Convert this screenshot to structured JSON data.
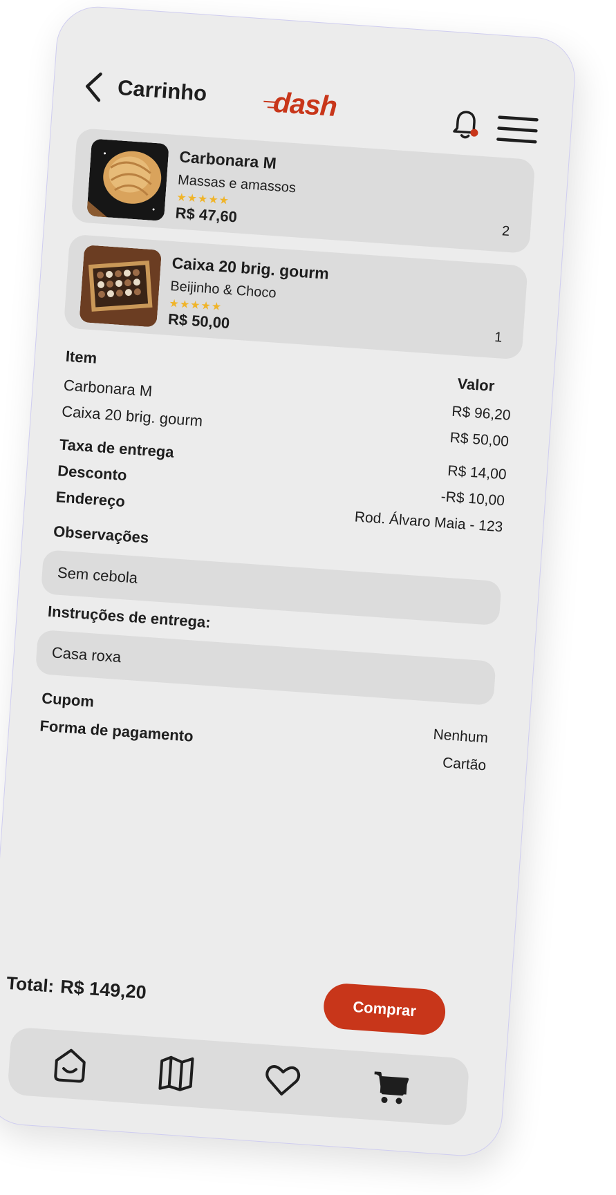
{
  "header": {
    "title": "Carrinho",
    "logo": "dash"
  },
  "cart": [
    {
      "name": "Carbonara M",
      "store": "Massas e amassos",
      "rating": 5,
      "price": "R$ 47,60",
      "quantity": "2"
    },
    {
      "name": "Caixa 20 brig. gourm",
      "store": "Beijinho & Choco",
      "rating": 5,
      "price": "R$ 50,00",
      "quantity": "1"
    }
  ],
  "summary": {
    "item_header": "Item",
    "value_header": "Valor",
    "items": [
      {
        "name": "Carbonara M",
        "value": "R$ 96,20"
      },
      {
        "name": "Caixa 20 brig. gourm",
        "value": "R$ 50,00"
      }
    ],
    "delivery_fee_label": "Taxa de entrega",
    "delivery_fee_value": "R$ 14,00",
    "discount_label": "Desconto",
    "discount_value": "-R$ 10,00",
    "address_label": "Endereço",
    "address_value": "Rod. Álvaro Maia - 123",
    "notes_label": "Observações",
    "notes_value": "Sem cebola",
    "delivery_instructions_label": "Instruções de entrega:",
    "delivery_instructions_value": "Casa roxa",
    "coupon_label": "Cupom",
    "coupon_value": "Nenhum",
    "payment_label": "Forma de pagamento",
    "payment_value": "Cartão"
  },
  "total": {
    "label": "Total:",
    "value": "R$ 149,20"
  },
  "buy_button": "Comprar",
  "nav": {
    "items": [
      "home-icon",
      "map-icon",
      "heart-icon",
      "cart-icon"
    ]
  },
  "colors": {
    "accent": "#c8361a",
    "background": "#ececec",
    "surface": "#dcdcdc",
    "star": "#f0b429"
  }
}
